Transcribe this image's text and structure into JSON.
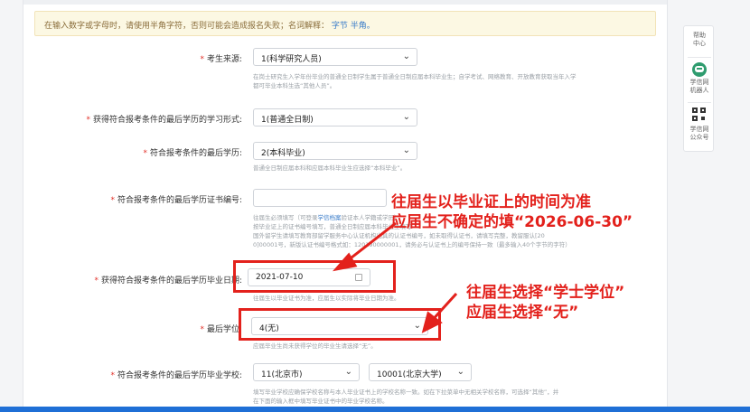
{
  "notice": {
    "text": "在输入数字或字母时，请使用半角字符，否则可能会造成报名失败；名词解释：",
    "link_fullwidth": "字节",
    "link_halfwidth": "半角。"
  },
  "fields": {
    "source": {
      "label": "考生来源:",
      "value": "1(科学研究人员)",
      "help": "在岗士研究生入学年份毕业的普通全日制学生属于普通全日制应届本科毕业生；自学考试、网络教育、开放教育获取当年入学都可毕业本科生选“其他人员”。"
    },
    "study_form": {
      "label": "获得符合报考条件的最后学历的学习形式:",
      "value": "1(普通全日制)"
    },
    "education": {
      "label": "符合报考条件的最后学历:",
      "value": "2(本科毕业)",
      "help": "普通全日制应届本科和应届本科毕业生应选择“本科毕业”。"
    },
    "certificate": {
      "label": "符合报考条件的最后学历证书编号:",
      "value": "",
      "help_prefix": "往届生必须填写（可登录",
      "help_link": "学信档案",
      "help_suffix": "验证本人学籍或学历）",
      "help_line2": "按毕业证上的证书编号填写，普通全日制应届本科毕业生填写",
      "help_line3": "国外留学生请填写教育部留学服务中心认证机构出具的认证书编号，如未取得认证书，请填写完整，教留服认[20",
      "help_line4": "0]00001号，新版认证书编号格式如：120190000001，请务必与认证书上的编号保持一致（最多输入40个字节的字符）"
    },
    "grad_date": {
      "label": "获得符合报考条件的最后学历毕业日期:",
      "value": "2021-07-10",
      "help": "往届生以毕业证书为准，应届生以实际将毕业日期为准。"
    },
    "degree": {
      "label": "最后学位:",
      "value": "4(无)",
      "help": "应届毕业生尚未获得学位的毕业生请选择“无”。"
    },
    "school": {
      "label": "符合报考条件的最后学历毕业学校:",
      "region": "11(北京市)",
      "name": "10001(北京大学)",
      "help1": "填写毕业学校应确保学校名称与本人毕业证书上的学校名称一致。如在下拉菜单中无相关学校名称，可选择“其他”，并",
      "help2": "在下面的输入框中填写毕业证书中的毕业学校名称。"
    }
  },
  "annotations": {
    "date_line1": "往届生以毕业证上的时间为准",
    "date_line2": "应届生不确定的填“2026-06-30”",
    "degree_line1": "往届生选择“学士学位”",
    "degree_line2": "应届生选择“无”"
  },
  "side_panel": {
    "help": "帮助中心",
    "robot": "学信网机器人",
    "official": "学信网公众号"
  },
  "colors": {
    "annotation": "#e3211c",
    "required": "#e2332b",
    "link": "#3a7cc9",
    "notice_bg": "#fcf8e3"
  }
}
